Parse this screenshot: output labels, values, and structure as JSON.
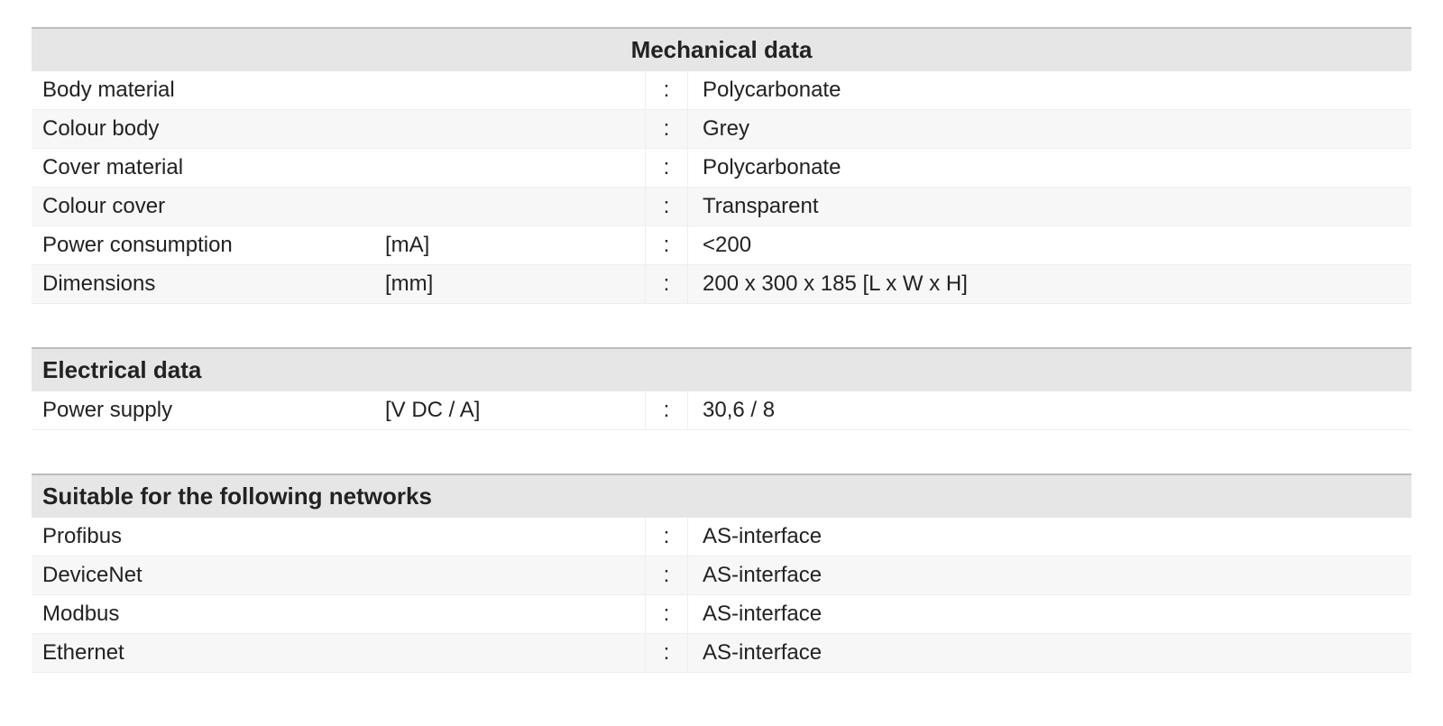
{
  "sections": [
    {
      "title": "Mechanical data",
      "title_align": "center",
      "rows": [
        {
          "label": "Body material",
          "unit": "",
          "value": "Polycarbonate"
        },
        {
          "label": "Colour body",
          "unit": "",
          "value": "Grey"
        },
        {
          "label": "Cover material",
          "unit": "",
          "value": "Polycarbonate"
        },
        {
          "label": "Colour cover",
          "unit": "",
          "value": "Transparent"
        },
        {
          "label": "Power consumption",
          "unit": "[mA]",
          "value": "<200"
        },
        {
          "label": "Dimensions",
          "unit": "[mm]",
          "value": "200 x 300 x 185  [L x W x H]"
        }
      ]
    },
    {
      "title": "Electrical data",
      "title_align": "left",
      "rows": [
        {
          "label": "Power supply",
          "unit": "[V DC / A]",
          "value": "30,6 / 8"
        }
      ]
    },
    {
      "title": "Suitable for the following networks",
      "title_align": "left",
      "rows": [
        {
          "label": "Profibus",
          "unit": "",
          "value": "AS-interface"
        },
        {
          "label": "DeviceNet",
          "unit": "",
          "value": "AS-interface"
        },
        {
          "label": "Modbus",
          "unit": "",
          "value": "AS-interface"
        },
        {
          "label": "Ethernet",
          "unit": "",
          "value": "AS-interface"
        }
      ]
    }
  ],
  "colon": ":"
}
